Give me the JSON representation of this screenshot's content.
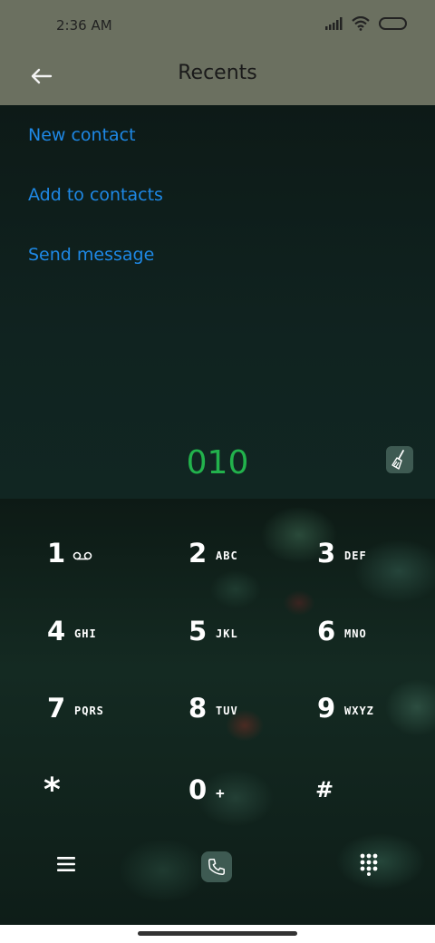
{
  "status_bar": {
    "time": "2:36 AM"
  },
  "header": {
    "title": "Recents"
  },
  "actions": [
    {
      "label": "New contact"
    },
    {
      "label": "Add to contacts"
    },
    {
      "label": "Send message"
    }
  ],
  "dialer": {
    "number": "010",
    "keys": [
      {
        "digit": "1",
        "letters": ""
      },
      {
        "digit": "2",
        "letters": "ABC"
      },
      {
        "digit": "3",
        "letters": "DEF"
      },
      {
        "digit": "4",
        "letters": "GHI"
      },
      {
        "digit": "5",
        "letters": "JKL"
      },
      {
        "digit": "6",
        "letters": "MNO"
      },
      {
        "digit": "7",
        "letters": "PQRS"
      },
      {
        "digit": "8",
        "letters": "TUV"
      },
      {
        "digit": "9",
        "letters": "WXYZ"
      },
      {
        "digit": "*",
        "letters": ""
      },
      {
        "digit": "0",
        "letters": "+"
      },
      {
        "digit": "#",
        "letters": ""
      }
    ]
  },
  "colors": {
    "accent": "#1e88e5",
    "number": "#22b24c",
    "header": "#6b7060"
  },
  "icons": [
    "back-arrow-icon",
    "signal-icon",
    "wifi-icon",
    "battery-icon",
    "broom-icon",
    "voicemail-icon",
    "menu-icon",
    "phone-icon",
    "keypad-icon"
  ]
}
